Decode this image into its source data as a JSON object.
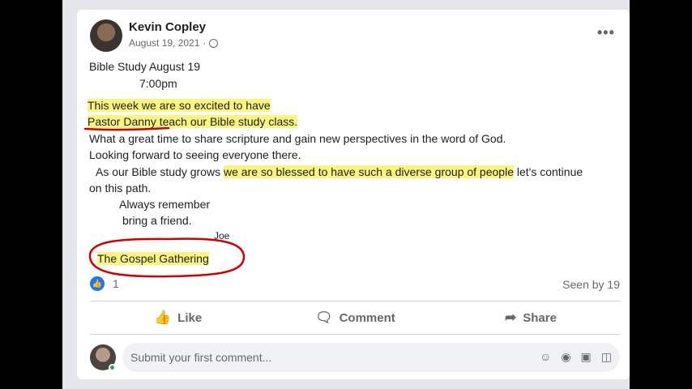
{
  "post": {
    "author": "Kevin Copley",
    "date": "August 19, 2021",
    "meta_sep": "·",
    "more_label": "•••",
    "lines": {
      "l1": "Bible Study August 19",
      "l2": "7:00pm",
      "l3": "This week we are so excited to have",
      "l4": "Pastor Danny teach our Bible study class.",
      "l5": "What a great time to share scripture and gain new perspectives in the word of God.",
      "l6": "Looking forward to seeing everyone there.",
      "l7a": "As our Bible study grows ",
      "l7b": "we are so blessed to have such a diverse group of people",
      "l7c": " let's continue",
      "l8": "on this path.",
      "l9": "Always remember",
      "l10": "bring a friend.",
      "l11": "Joe",
      "l12": "The Gospel Gathering"
    }
  },
  "reactions": {
    "count": "1",
    "seen": "Seen by 19"
  },
  "actions": {
    "like": "Like",
    "comment": "Comment",
    "share": "Share"
  },
  "comment": {
    "placeholder": "Submit your first comment..."
  },
  "colors": {
    "highlight": "#fbf57f",
    "ink": "#d00000",
    "like_blue": "#1877f2"
  },
  "icons": [
    "globe-icon",
    "more-icon",
    "like-reaction-icon",
    "thumbs-up-icon",
    "comment-icon",
    "share-icon",
    "emoji-icon",
    "camera-icon",
    "gif-icon",
    "sticker-icon"
  ]
}
